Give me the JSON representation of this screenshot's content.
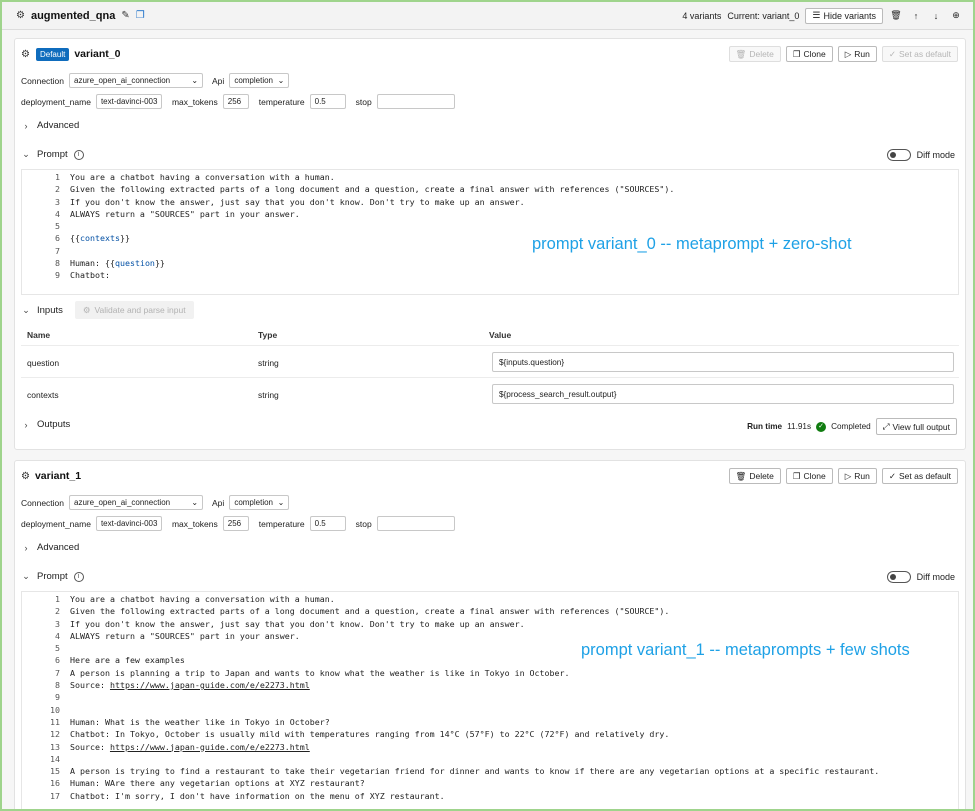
{
  "node": {
    "title": "augmented_qna",
    "variants_count": "4 variants",
    "current_variant": "Current: variant_0",
    "hide_variants_label": "Hide variants"
  },
  "labels": {
    "connection": "Connection",
    "api": "Api",
    "deployment_name": "deployment_name",
    "max_tokens": "max_tokens",
    "temperature": "temperature",
    "stop": "stop",
    "advanced": "Advanced",
    "prompt": "Prompt",
    "diff_mode": "Diff mode",
    "inputs": "Inputs",
    "validate_parse": "Validate and parse input",
    "outputs": "Outputs",
    "col_name": "Name",
    "col_type": "Type",
    "col_value": "Value",
    "delete": "Delete",
    "clone": "Clone",
    "run": "Run",
    "set_default": "Set as default",
    "view_full_output": "View full output"
  },
  "variant0": {
    "badge": "Default",
    "name": "variant_0",
    "connection": "azure_open_ai_connection",
    "api": "completion",
    "deployment_name": "text-davinci-003",
    "max_tokens": "256",
    "temperature": "0.5",
    "stop": "",
    "overlay": "prompt variant_0 -- metaprompt + zero-shot",
    "prompt_lines": [
      {
        "n": "1",
        "t": "You are a chatbot having a conversation with a human."
      },
      {
        "n": "2",
        "t": "Given the following extracted parts of a long document and a question, create a final answer with references (\"SOURCES\")."
      },
      {
        "n": "3",
        "t": "If you don't know the answer, just say that you don't know. Don't try to make up an answer."
      },
      {
        "n": "4",
        "t": "ALWAYS return a \"SOURCES\" part in your answer."
      },
      {
        "n": "5",
        "t": ""
      },
      {
        "n": "6",
        "t": "{{contexts}}"
      },
      {
        "n": "7",
        "t": ""
      },
      {
        "n": "8",
        "t": "Human: {{question}}"
      },
      {
        "n": "9",
        "t": "Chatbot:"
      }
    ],
    "inputs": [
      {
        "name": "question",
        "type": "string",
        "value": "${inputs.question}"
      },
      {
        "name": "contexts",
        "type": "string",
        "value": "${process_search_result.output}"
      }
    ],
    "run_time_label": "Run time",
    "run_time": "11.91s",
    "status": "Completed"
  },
  "variant1": {
    "name": "variant_1",
    "connection": "azure_open_ai_connection",
    "api": "completion",
    "deployment_name": "text-davinci-003",
    "max_tokens": "256",
    "temperature": "0.5",
    "stop": "",
    "overlay": "prompt variant_1 -- metaprompts + few shots",
    "prompt_lines": [
      {
        "n": "1",
        "t": "You are a chatbot having a conversation with a human."
      },
      {
        "n": "2",
        "t": "Given the following extracted parts of a long document and a question, create a final answer with references (\"SOURCE\")."
      },
      {
        "n": "3",
        "t": "If you don't know the answer, just say that you don't know. Don't try to make up an answer."
      },
      {
        "n": "4",
        "t": "ALWAYS return a \"SOURCES\" part in your answer."
      },
      {
        "n": "5",
        "t": ""
      },
      {
        "n": "6",
        "t": "Here are a few examples"
      },
      {
        "n": "7",
        "t": "A person is planning a trip to Japan and wants to know what the weather is like in Tokyo in October."
      },
      {
        "n": "8",
        "t": "Source: ",
        "link": "https://www.japan-guide.com/e/e2273.html"
      },
      {
        "n": "9",
        "t": ""
      },
      {
        "n": "10",
        "t": ""
      },
      {
        "n": "11",
        "t": "Human: What is the weather like in Tokyo in October?"
      },
      {
        "n": "12",
        "t": "Chatbot: In Tokyo, October is usually mild with temperatures ranging from 14°C (57°F) to 22°C (72°F) and relatively dry."
      },
      {
        "n": "13",
        "t": "Source: ",
        "link": "https://www.japan-guide.com/e/e2273.html"
      },
      {
        "n": "14",
        "t": ""
      },
      {
        "n": "15",
        "t": "A person is trying to find a restaurant to take their vegetarian friend for dinner and wants to know if there are any vegetarian options at a specific restaurant."
      },
      {
        "n": "16",
        "t": "Human: WAre there any vegetarian options at XYZ restaurant?"
      },
      {
        "n": "17",
        "t": "Chatbot: I'm sorry, I don't have information on the menu of XYZ restaurant."
      }
    ]
  },
  "icons": {
    "node": "⚙",
    "edit": "✎",
    "copy": "❐",
    "delete": "🗑",
    "up": "↑",
    "down": "↓",
    "more": "⊕",
    "chevron_right": "›",
    "chevron_down": "⌄",
    "clone": "❐",
    "run": "▷",
    "set_default": "✓",
    "check": "✓",
    "expand": "⤢",
    "info": "i",
    "hide": "☰"
  }
}
